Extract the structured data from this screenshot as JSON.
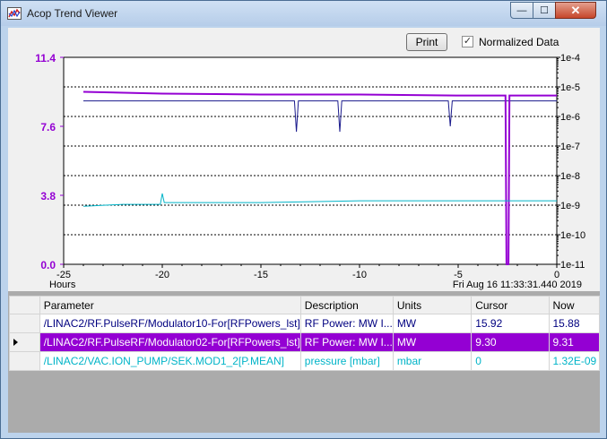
{
  "window": {
    "title": "Acop Trend Viewer",
    "minimize_glyph": "—",
    "maximize_glyph": "☐",
    "close_glyph": "✕"
  },
  "toolbar": {
    "print_label": "Print",
    "normalized_label": "Normalized Data",
    "normalized_checked": true,
    "check_glyph": "✓"
  },
  "colors": {
    "series1": "#1a1a8c",
    "series2": "#9400d3",
    "series3": "#00b4c8",
    "left_axis": "#9400d3",
    "right_axis": "#000000"
  },
  "chart_data": {
    "type": "line",
    "xlabel": "Hours",
    "xlim": [
      -25,
      0
    ],
    "xticks": [
      "-25",
      "-20",
      "-15",
      "-10",
      "-5",
      "0"
    ],
    "timestamp": "Fri Aug 16 11:33:31.440 2019",
    "left_axis": {
      "ylim": [
        0.0,
        11.4
      ],
      "ticks": [
        "11.4",
        "7.6",
        "3.8",
        "0.0"
      ]
    },
    "right_axis": {
      "scale": "log",
      "ticks": [
        "1e-4",
        "1e-5",
        "1e-6",
        "1e-7",
        "1e-8",
        "1e-9",
        "1e-10",
        "1e-11"
      ]
    },
    "grid": "horizontal-dashed",
    "series": [
      {
        "name": "/LINAC2/RF.PulseRF/Modulator10-For[RFPowers_lst]",
        "x": [
          -24,
          -20,
          -15,
          -13.3,
          -13.2,
          -13.1,
          -11.1,
          -11.0,
          -10.9,
          -5.5,
          -5.4,
          -5.3,
          0
        ],
        "values": [
          9.0,
          9.0,
          9.0,
          9.0,
          7.3,
          9.0,
          9.0,
          7.3,
          9.0,
          9.0,
          7.6,
          9.0,
          9.0
        ]
      },
      {
        "name": "/LINAC2/RF.PulseRF/Modulator02-For[RFPowers_lst]",
        "x": [
          -24,
          -20,
          -15,
          -10,
          -5,
          -2.6,
          -2.55,
          -2.45,
          -2.4,
          0
        ],
        "values": [
          9.5,
          9.4,
          9.35,
          9.35,
          9.3,
          9.3,
          0.0,
          0.0,
          9.3,
          9.3
        ]
      },
      {
        "name": "/LINAC2/VAC.ION_PUMP/SEK.MOD1_2[P.MEAN]",
        "x": [
          -24,
          -22,
          -20.1,
          -20.0,
          -19.9,
          -18,
          -15,
          -10,
          -5,
          -3,
          -2,
          0
        ],
        "values": [
          3.2,
          3.3,
          3.3,
          3.9,
          3.4,
          3.4,
          3.4,
          3.5,
          3.5,
          3.5,
          3.5,
          3.5
        ]
      }
    ]
  },
  "table": {
    "headers": [
      "Parameter",
      "Description",
      "Units",
      "Cursor",
      "Now"
    ],
    "rows": [
      [
        "/LINAC2/RF.PulseRF/Modulator10-For[RFPowers_lst]",
        "RF Power: MW I...",
        "MW",
        "15.92",
        "15.88"
      ],
      [
        "/LINAC2/RF.PulseRF/Modulator02-For[RFPowers_lst]",
        "RF Power: MW I...",
        "MW",
        "9.30",
        "9.31"
      ],
      [
        "/LINAC2/VAC.ION_PUMP/SEK.MOD1_2[P.MEAN]",
        "pressure [mbar]",
        "mbar",
        "0",
        "1.32E-09"
      ]
    ],
    "selected_row": 1
  }
}
